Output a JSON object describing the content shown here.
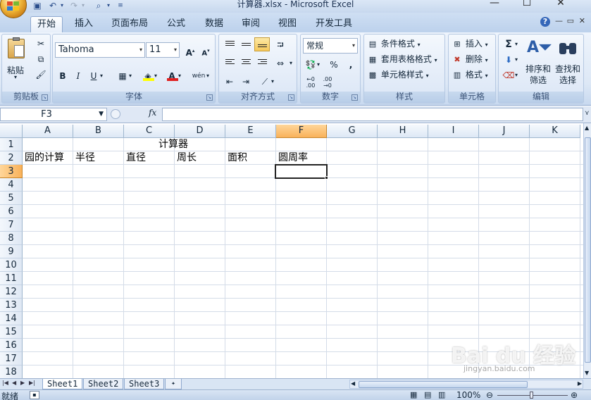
{
  "window": {
    "title": "计算器.xlsx - Microsoft Excel",
    "controls": [
      "—",
      "☐",
      "✕"
    ]
  },
  "quick_access": {
    "icons": [
      "save-icon",
      "undo-icon",
      "redo-icon",
      "print-preview-icon",
      "customize-icon"
    ]
  },
  "tabs": [
    {
      "label": "开始",
      "active": true
    },
    {
      "label": "插入"
    },
    {
      "label": "页面布局"
    },
    {
      "label": "公式"
    },
    {
      "label": "数据"
    },
    {
      "label": "审阅"
    },
    {
      "label": "视图"
    },
    {
      "label": "开发工具"
    }
  ],
  "ribbon": {
    "clipboard": {
      "label": "剪贴板",
      "paste": "粘贴"
    },
    "font": {
      "label": "字体",
      "name": "Tahoma",
      "size": "11"
    },
    "alignment": {
      "label": "对齐方式"
    },
    "number": {
      "label": "数字",
      "format": "常规"
    },
    "styles": {
      "label": "样式",
      "conditional": "条件格式",
      "table": "套用表格格式",
      "cell": "单元格样式"
    },
    "cells": {
      "label": "单元格",
      "insert": "插入",
      "delete": "删除",
      "format": "格式"
    },
    "editing": {
      "label": "编辑",
      "sort1": "排序和",
      "sort2": "筛选",
      "find1": "查找和",
      "find2": "选择"
    }
  },
  "formula_bar": {
    "name_box": "F3",
    "fx": "fx",
    "value": ""
  },
  "grid": {
    "columns": [
      "A",
      "B",
      "C",
      "D",
      "E",
      "F",
      "G",
      "H",
      "I",
      "J",
      "K"
    ],
    "selected_column": "F",
    "rows": [
      "1",
      "2",
      "3",
      "4",
      "5",
      "6",
      "7",
      "8",
      "9",
      "10",
      "11",
      "12",
      "13",
      "14",
      "15",
      "16",
      "17",
      "18"
    ],
    "selected_row": "3",
    "cells": {
      "C1": "计算器",
      "A2": "园的计算",
      "B2": "半径",
      "C2": "直径",
      "D2": "周长",
      "E2": "面积",
      "F2": "圆周率"
    },
    "active_cell": "F3"
  },
  "sheets": [
    {
      "label": "Sheet1",
      "active": true
    },
    {
      "label": "Sheet2"
    },
    {
      "label": "Sheet3"
    }
  ],
  "status": {
    "mode": "就绪",
    "zoom": "100%"
  },
  "watermark": {
    "text": "Bai du 经验",
    "url": "jingyan.baidu.com"
  }
}
